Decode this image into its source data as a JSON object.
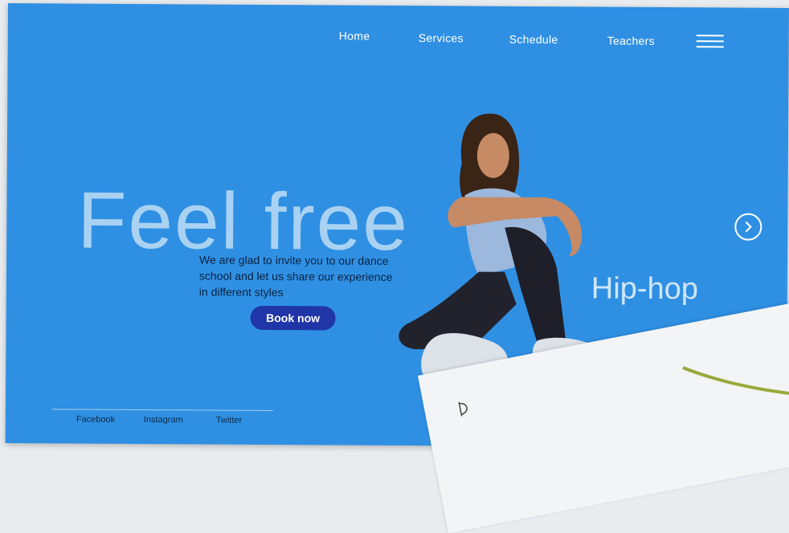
{
  "nav": {
    "home": "Home",
    "services": "Services",
    "schedule": "Schedule",
    "teachers": "Teachers"
  },
  "hero": {
    "title": "Feel free",
    "text": "We are glad to invite you to our dance school and let us share our experience in different styles",
    "cta": "Book now"
  },
  "slider": {
    "style": "Hip-hop"
  },
  "social": {
    "facebook": "Facebook",
    "instagram": "Instagram",
    "twitter": "Twitter"
  },
  "icons": {
    "menu": "hamburger-menu-icon",
    "next": "chevron-right-icon"
  },
  "colors": {
    "background": "#2f90e3",
    "accent_button": "#1f35a8",
    "title": "#a9d2f2"
  }
}
